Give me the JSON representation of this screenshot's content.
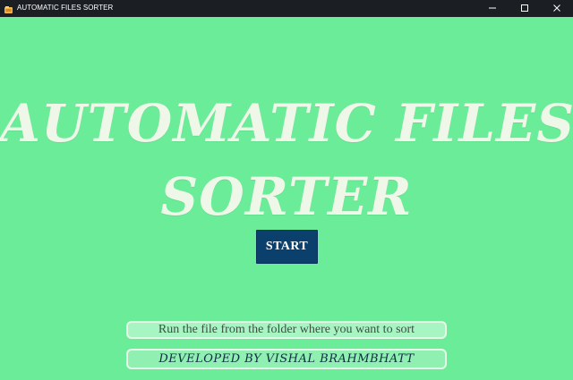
{
  "window": {
    "title": "AUTOMATIC FILES SORTER",
    "controls": {
      "minimize_icon": "minimize-icon",
      "maximize_icon": "maximize-icon",
      "close_icon": "close-icon"
    }
  },
  "main": {
    "headline_line_1": "AUTOMATIC FILES",
    "headline_line_2": "SORTER",
    "start_label": "START",
    "instruction": "Run the file from the folder where you want to sort",
    "credit": "DEVELOPED BY VISHAL BRAHMBHATT"
  },
  "colors": {
    "background": "#6bec98",
    "title_bar": "#1b1f24",
    "headline": "#eef7e8",
    "button": "#0b3f6c",
    "credit_text": "#112c45"
  }
}
